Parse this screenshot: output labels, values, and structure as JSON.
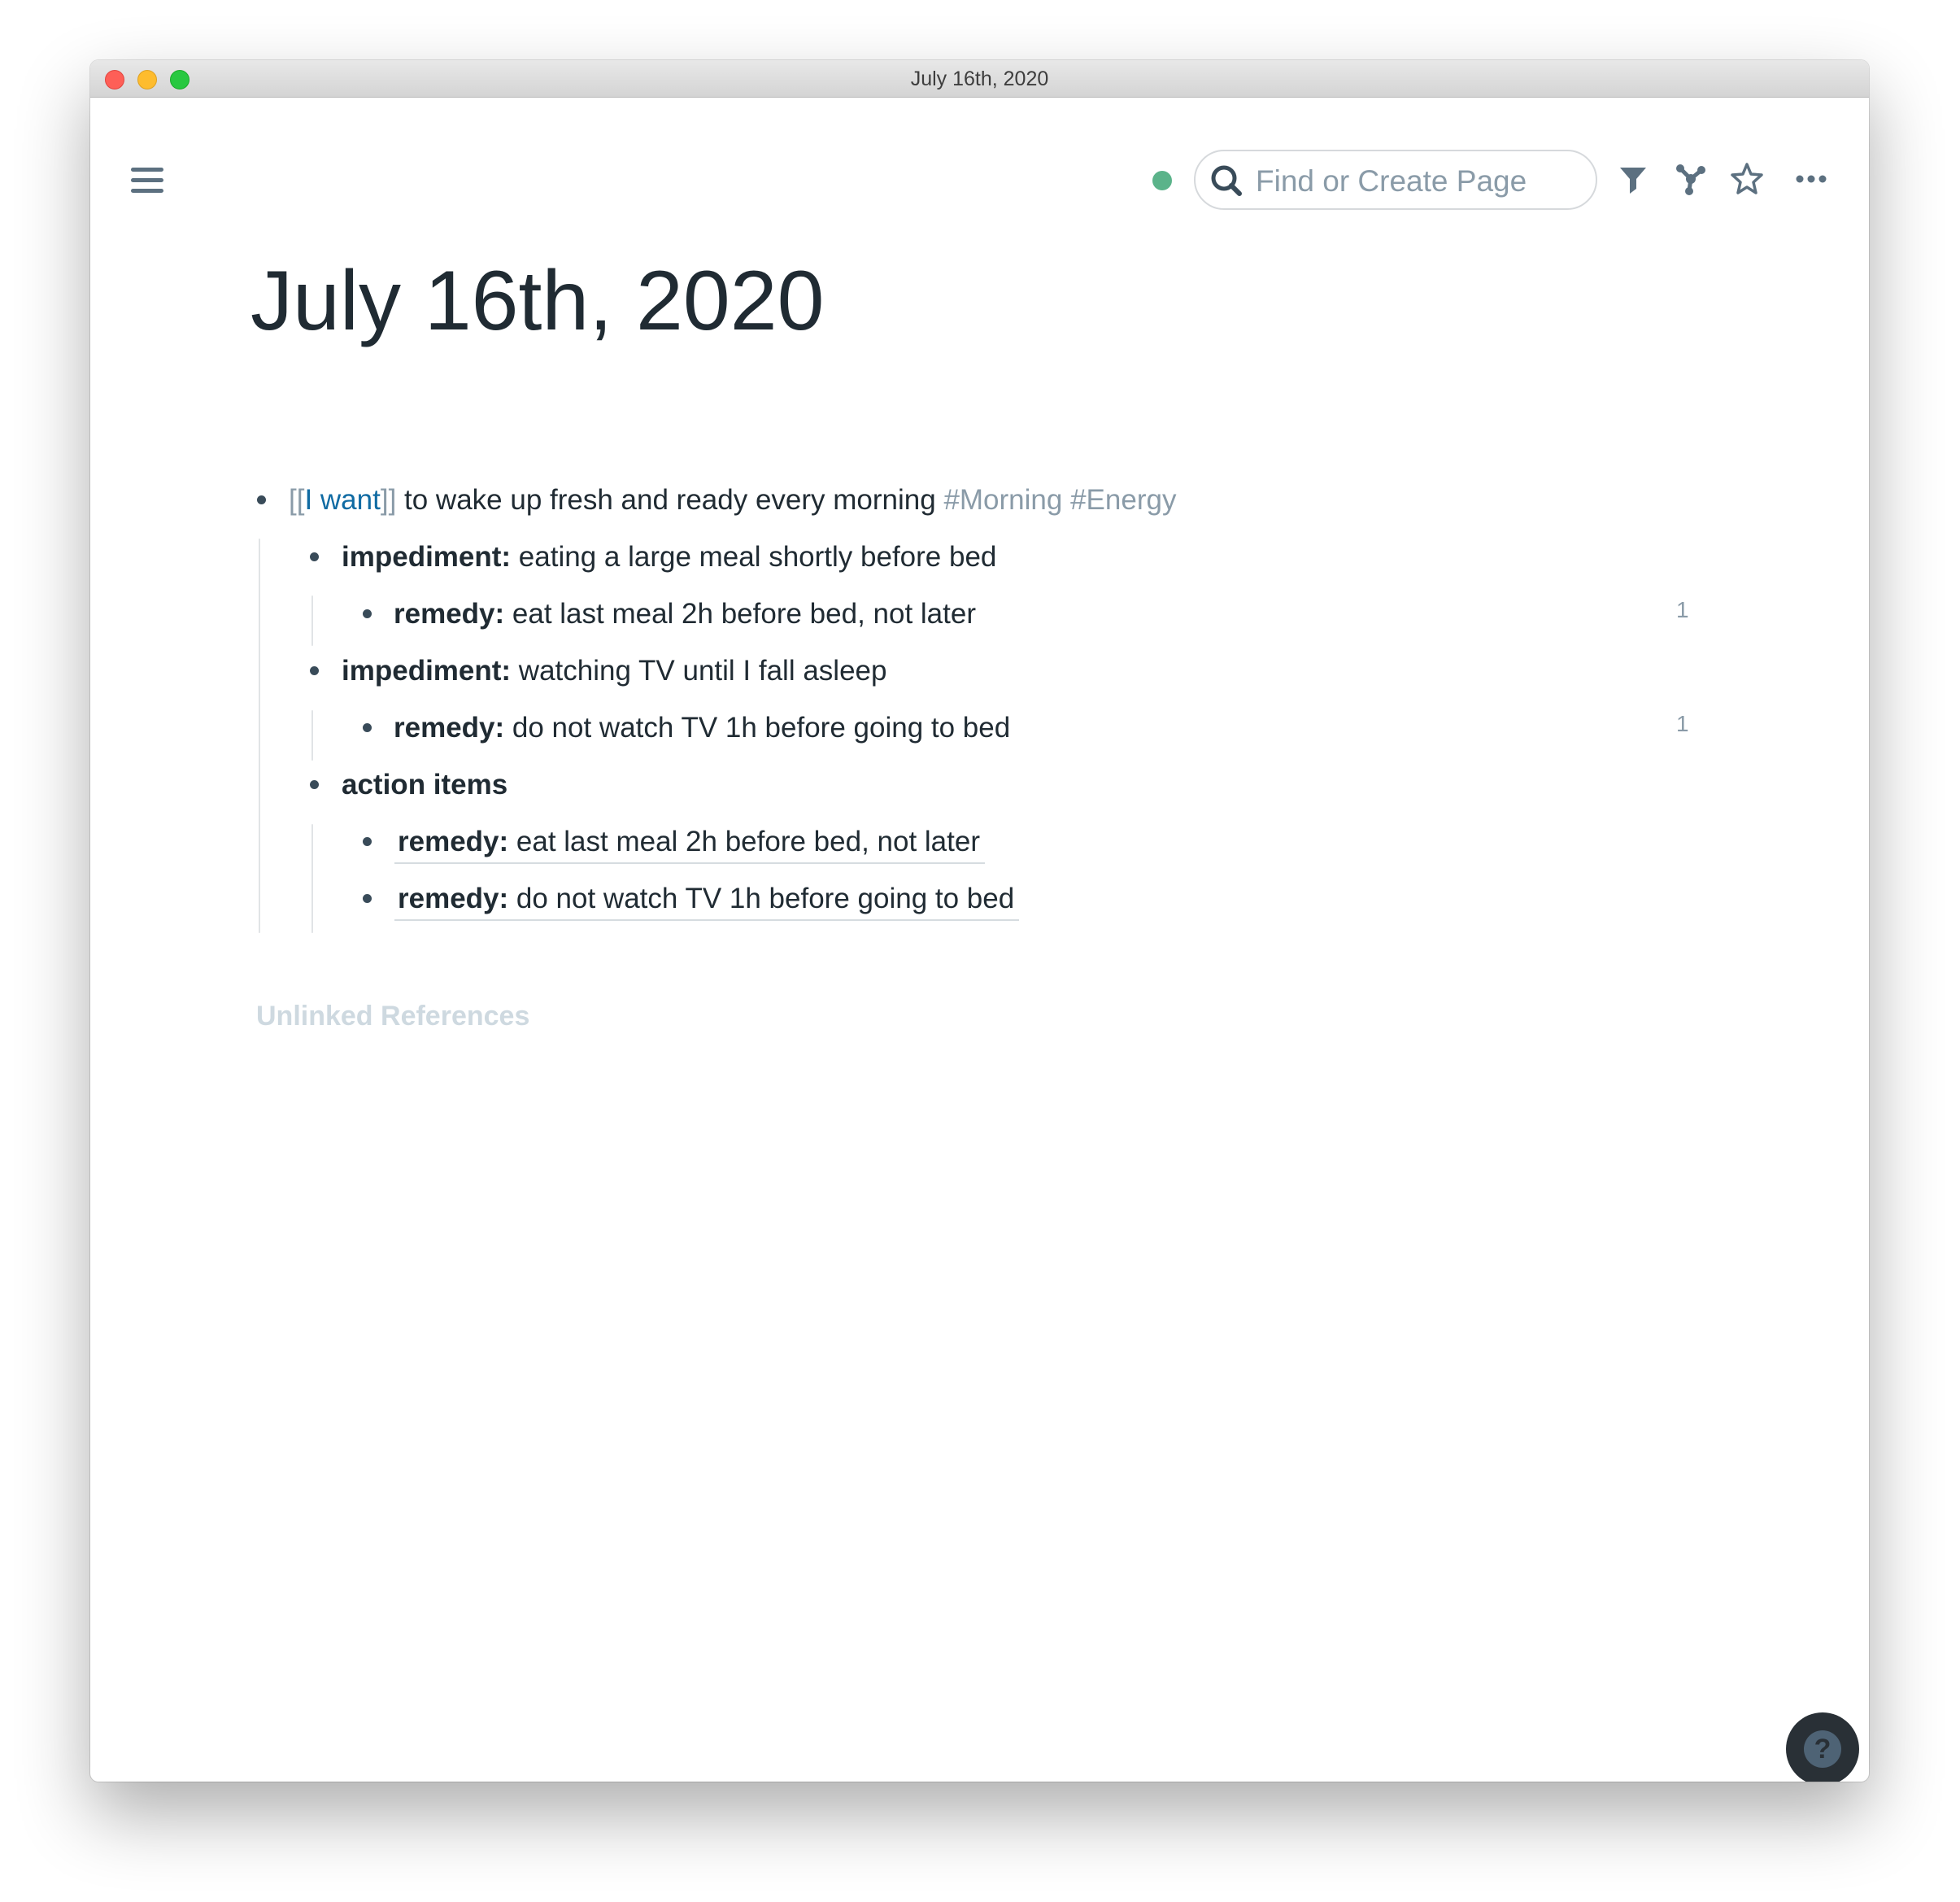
{
  "window": {
    "title": "July 16th, 2020"
  },
  "toolbar": {
    "menu_icon": "hamburger-menu-icon",
    "sync_status_color": "#5bb38a",
    "search": {
      "placeholder": "Find or Create Page",
      "value": ""
    },
    "icons": [
      "filter-icon",
      "graph-icon",
      "star-icon",
      "more-icon"
    ]
  },
  "page": {
    "title": "July 16th, 2020",
    "blocks": [
      {
        "level": 1,
        "link_open": "[[",
        "link_text": "I want",
        "link_close": "]]",
        "text": " to wake up fresh and ready every morning ",
        "tags": [
          "#Morning",
          "#Energy"
        ]
      },
      {
        "level": 2,
        "label": "impediment:",
        "text": " eating a large meal shortly before bed"
      },
      {
        "level": 3,
        "label": "remedy:",
        "text": " eat last meal 2h before bed, not later",
        "ref_count": "1"
      },
      {
        "level": 2,
        "label": "impediment:",
        "text": " watching TV until I fall asleep"
      },
      {
        "level": 3,
        "label": "remedy:",
        "text": " do not watch TV 1h before going to bed",
        "ref_count": "1"
      },
      {
        "level": 2,
        "label": "action items",
        "text": ""
      },
      {
        "level": 3,
        "label": "remedy:",
        "text": " eat last meal 2h before bed, not later",
        "block_ref": true
      },
      {
        "level": 3,
        "label": "remedy:",
        "text": " do not watch TV 1h before going to bed",
        "block_ref": true
      }
    ],
    "unlinked_references_label": "Unlinked References"
  },
  "help": {
    "label": "?"
  },
  "colors": {
    "link": "#106ba3",
    "tag": "#8a9ba8",
    "text": "#202b33",
    "muted_heading": "#ced9e0"
  }
}
